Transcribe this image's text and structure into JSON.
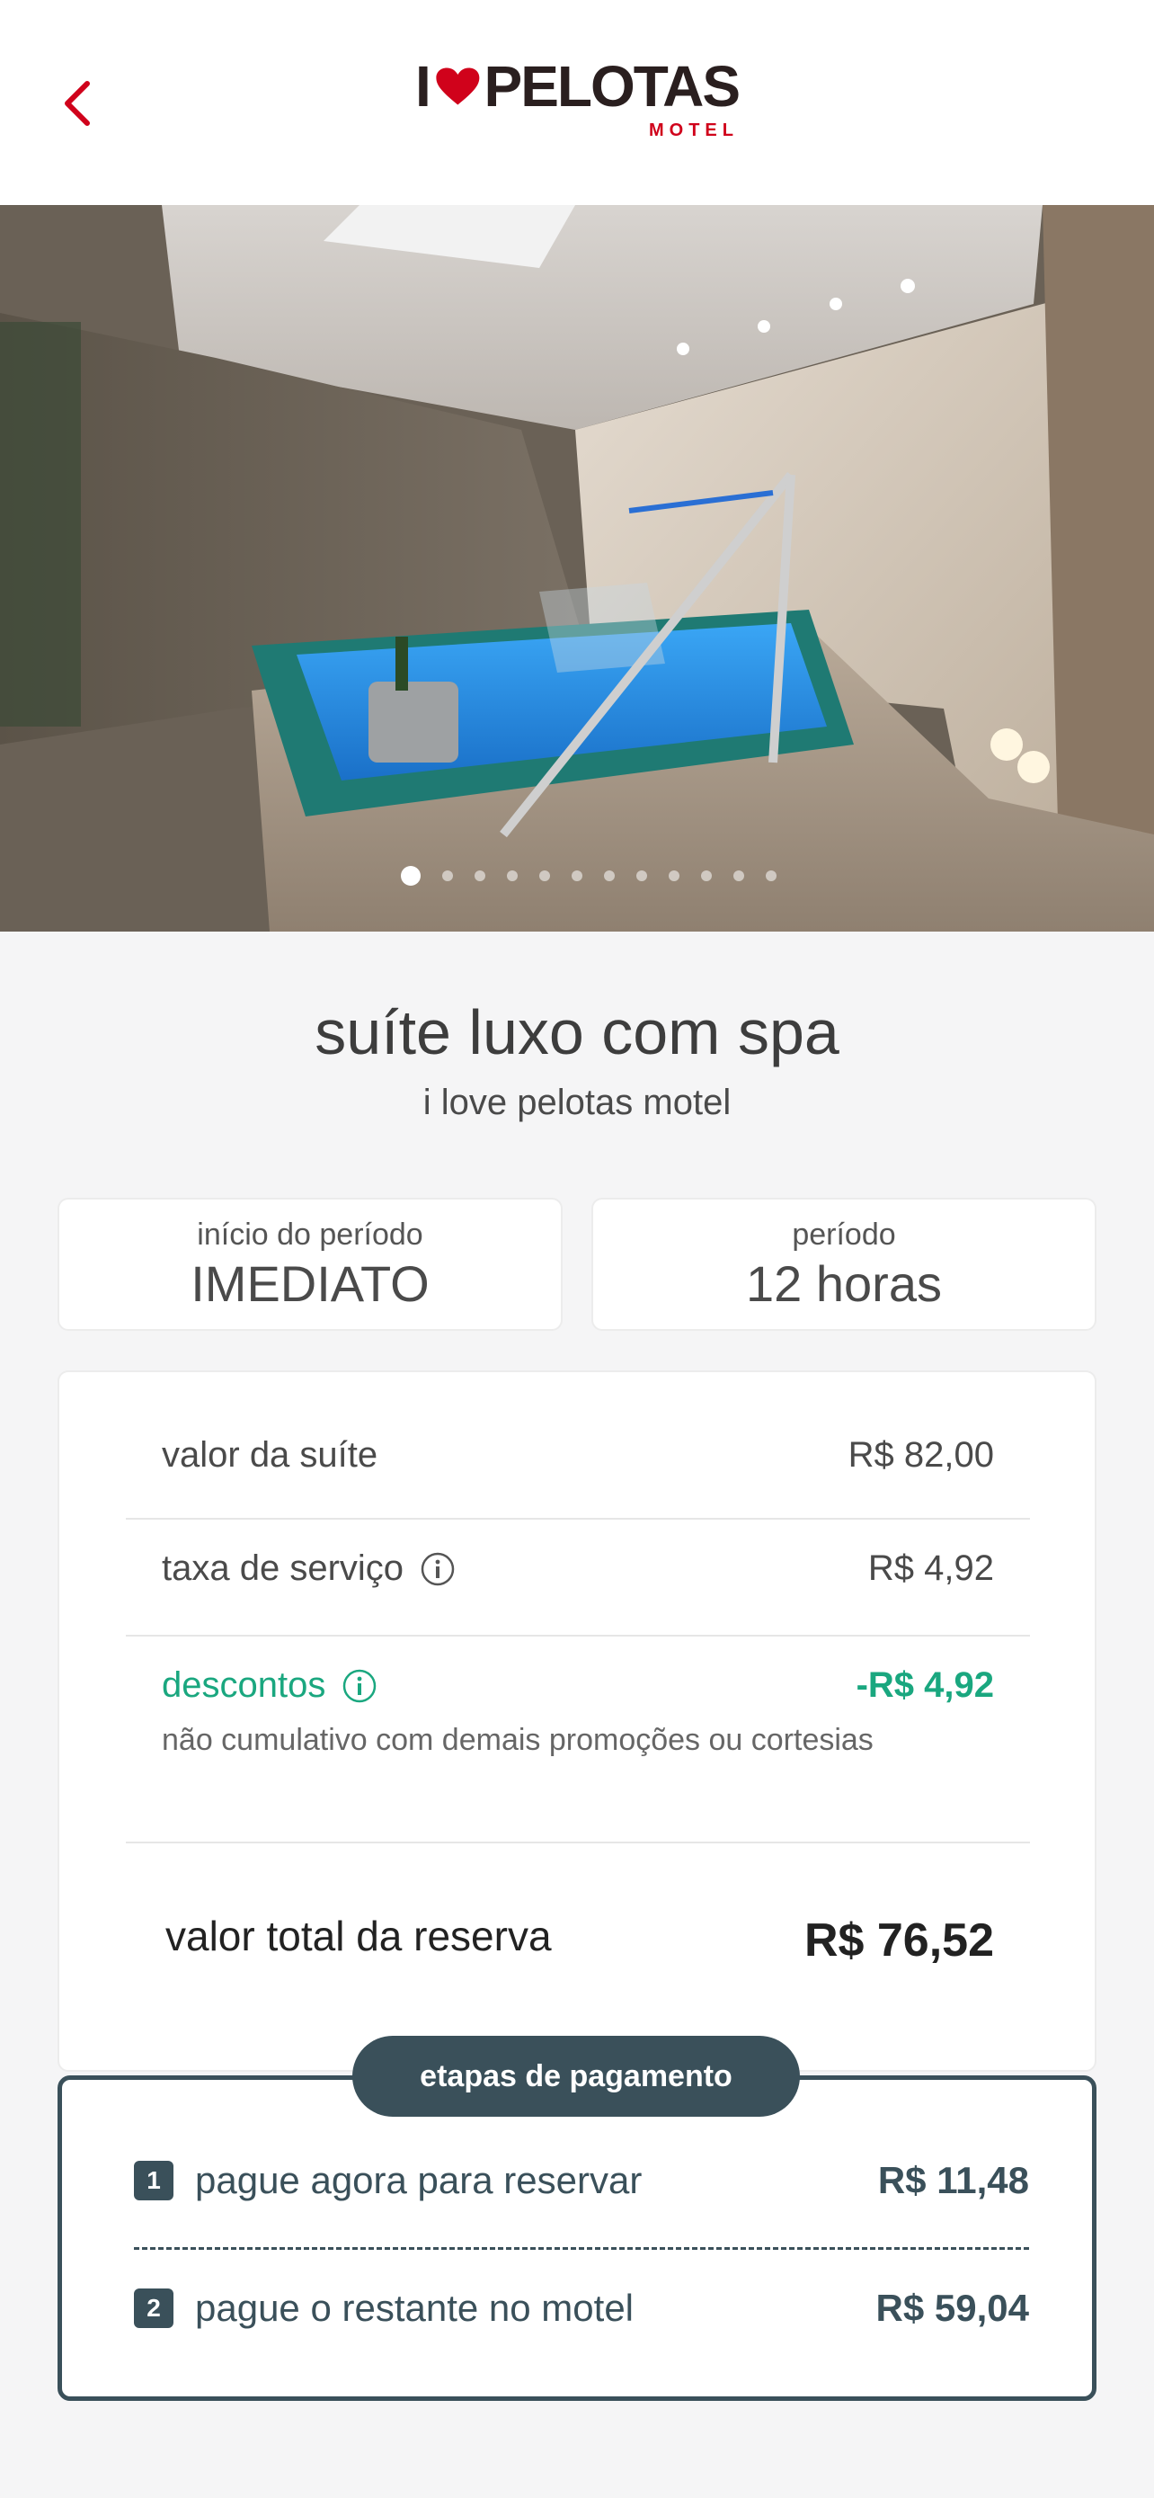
{
  "header": {
    "logo_i": "I",
    "logo_word": "PELOTAS",
    "logo_sub": "MOTEL"
  },
  "carousel": {
    "total_images": 12,
    "active_index": 0
  },
  "suite": {
    "title": "suíte luxo com spa",
    "motel": "i love pelotas motel"
  },
  "period": {
    "start_label": "início do período",
    "start_value": "IMEDIATO",
    "duration_label": "período",
    "duration_value": "12 horas"
  },
  "pricing": {
    "suite_label": "valor da suíte",
    "suite_value": "R$ 82,00",
    "service_label": "taxa de serviço",
    "service_value": "R$ 4,92",
    "discount_label": "descontos",
    "discount_value": "-R$ 4,92",
    "discount_note": "não cumulativo com demais promoções ou cortesias",
    "total_label": "valor total da reserva",
    "total_value": "R$ 76,52"
  },
  "payment": {
    "title": "etapas de pagamento",
    "steps": [
      {
        "number": "1",
        "label": "pague agora para reservar",
        "value": "R$ 11,48"
      },
      {
        "number": "2",
        "label": "pague o restante no motel",
        "value": "R$ 59,04"
      }
    ]
  },
  "colors": {
    "accent_red": "#d0021b",
    "discount_green": "#1aa77f",
    "payment_slate": "#3a505a"
  },
  "icons": {
    "back": "chevron-left-icon",
    "info": "info-icon",
    "logo_heart": "heart-icon"
  }
}
